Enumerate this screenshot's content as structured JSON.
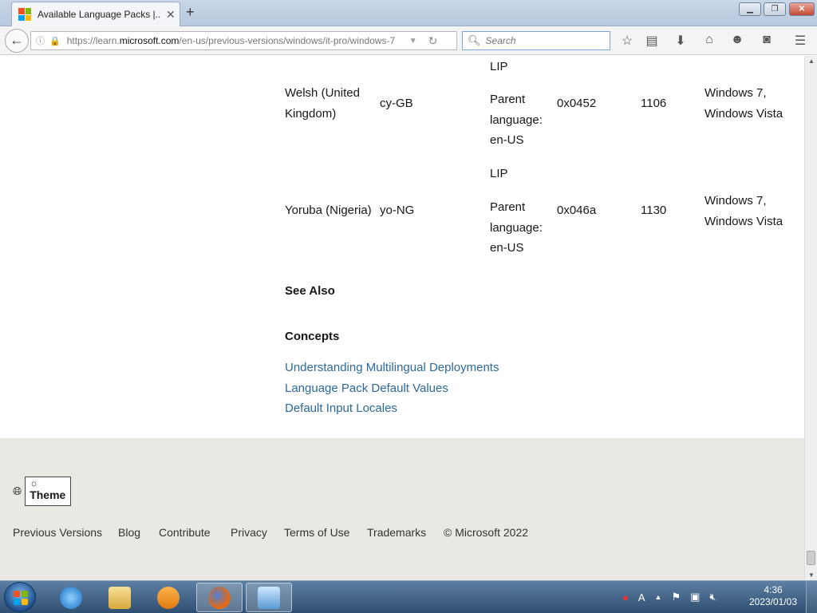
{
  "browser": {
    "tab_title": "Available Language Packs |...",
    "url_prefix": "https://learn.",
    "url_domain": "microsoft.com",
    "url_rest": "/en-us/previous-versions/windows/it-pro/windows-7",
    "search_placeholder": "Search"
  },
  "table": {
    "top_fragment": "LIP",
    "rows": [
      {
        "language": "Welsh (United Kingdom)",
        "tag": "cy-GB",
        "lip_label": "",
        "type": "Parent language: en-US",
        "lcid": "0x0452",
        "decimal": "1106",
        "os": "Windows 7, Windows Vista"
      },
      {
        "language": "Yoruba (Nigeria)",
        "tag": "yo-NG",
        "lip_label": "LIP",
        "type": "Parent language: en-US",
        "lcid": "0x046a",
        "decimal": "1130",
        "os": "Windows 7, Windows Vista"
      }
    ]
  },
  "see_also": {
    "heading": "See Also",
    "subheading": "Concepts",
    "links": [
      "Understanding Multilingual Deployments",
      "Language Pack Default Values",
      "Default Input Locales"
    ]
  },
  "footer": {
    "theme_label": "Theme",
    "links": [
      "Previous Versions",
      "Blog",
      "Contribute",
      "Privacy",
      "Terms of Use",
      "Trademarks"
    ],
    "copyright": "© Microsoft 2022"
  },
  "taskbar": {
    "time": "4:36",
    "date": "2023/01/03"
  },
  "colors": {
    "link": "#2b6a9c",
    "footer_bg": "#eae8e3",
    "taskbar": "#2f4f71"
  }
}
